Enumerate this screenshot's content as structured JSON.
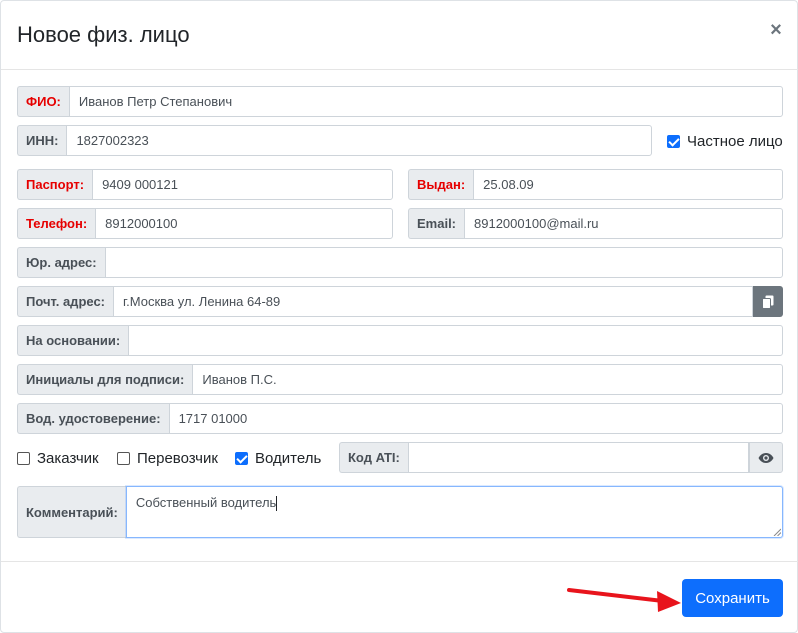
{
  "modal": {
    "title": "Новое физ. лицо",
    "close_symbol": "×"
  },
  "fields": {
    "fio": {
      "label": "ФИО:",
      "value": "Иванов Петр Степанович"
    },
    "inn": {
      "label": "ИНН:",
      "value": "1827002323"
    },
    "private_person": {
      "label": "Частное лицо",
      "checked": true
    },
    "passport": {
      "label": "Паспорт:",
      "value": "9409 000121"
    },
    "issued": {
      "label": "Выдан:",
      "value": "25.08.09"
    },
    "phone": {
      "label": "Телефон:",
      "value": "8912000100"
    },
    "email": {
      "label": "Email:",
      "value": "8912000100@mail.ru"
    },
    "legal_address": {
      "label": "Юр. адрес:",
      "value": ""
    },
    "postal_address": {
      "label": "Почт. адрес:",
      "value": "г.Москва ул. Ленина 64-89"
    },
    "basis": {
      "label": "На основании:",
      "value": ""
    },
    "signature_initials": {
      "label": "Инициалы для подписи:",
      "value": "Иванов П.С."
    },
    "driver_license": {
      "label": "Вод. удостоверение:",
      "value": "1717 01000"
    },
    "customer": {
      "label": "Заказчик",
      "checked": false
    },
    "carrier": {
      "label": "Перевозчик",
      "checked": false
    },
    "driver": {
      "label": "Водитель",
      "checked": true
    },
    "ati_code": {
      "label": "Код ATI:",
      "value": ""
    },
    "comment": {
      "label": "Комментарий:",
      "value": "Собственный водитель"
    }
  },
  "icons": {
    "copy": "copy-icon",
    "eye": "eye-icon"
  },
  "footer": {
    "save_label": "Сохранить"
  },
  "colors": {
    "required_label": "#e60000",
    "primary": "#0d6efd",
    "annotation_arrow": "#e8141c"
  }
}
